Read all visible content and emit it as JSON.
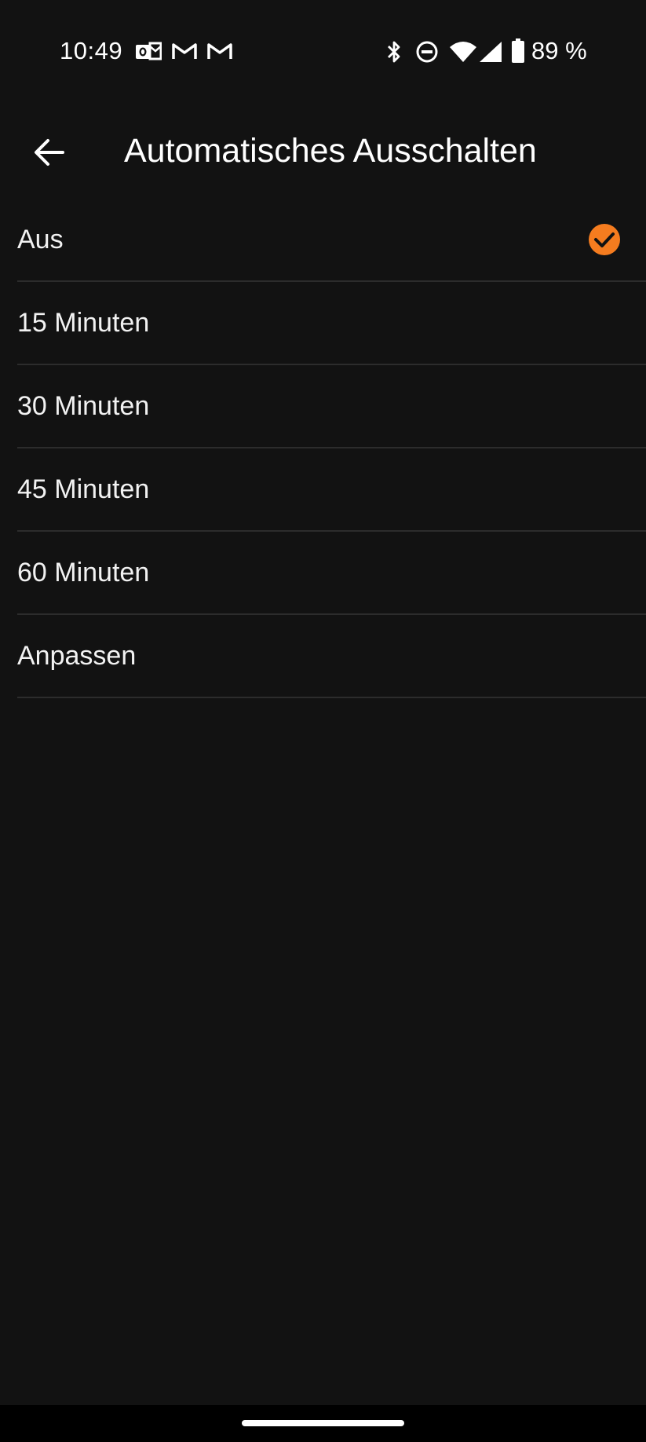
{
  "status_bar": {
    "time": "10:49",
    "battery_percent_text": "89 %",
    "notification_icons": [
      "outlook-icon",
      "gmail-icon",
      "gmail-icon"
    ],
    "system_icons": [
      "bluetooth-icon",
      "do-not-disturb-icon",
      "wifi-icon",
      "cellular-signal-icon",
      "battery-icon"
    ]
  },
  "app_bar": {
    "back_icon": "arrow-left-icon",
    "title": "Automatisches Ausschalten"
  },
  "options": [
    {
      "label": "Aus",
      "selected": true
    },
    {
      "label": "15 Minuten",
      "selected": false
    },
    {
      "label": "30 Minuten",
      "selected": false
    },
    {
      "label": "45 Minuten",
      "selected": false
    },
    {
      "label": "60 Minuten",
      "selected": false
    },
    {
      "label": "Anpassen",
      "selected": false
    }
  ],
  "colors": {
    "background": "#121212",
    "accent": "#f57c1f",
    "divider": "#2c2c2c",
    "text": "#ffffff"
  }
}
